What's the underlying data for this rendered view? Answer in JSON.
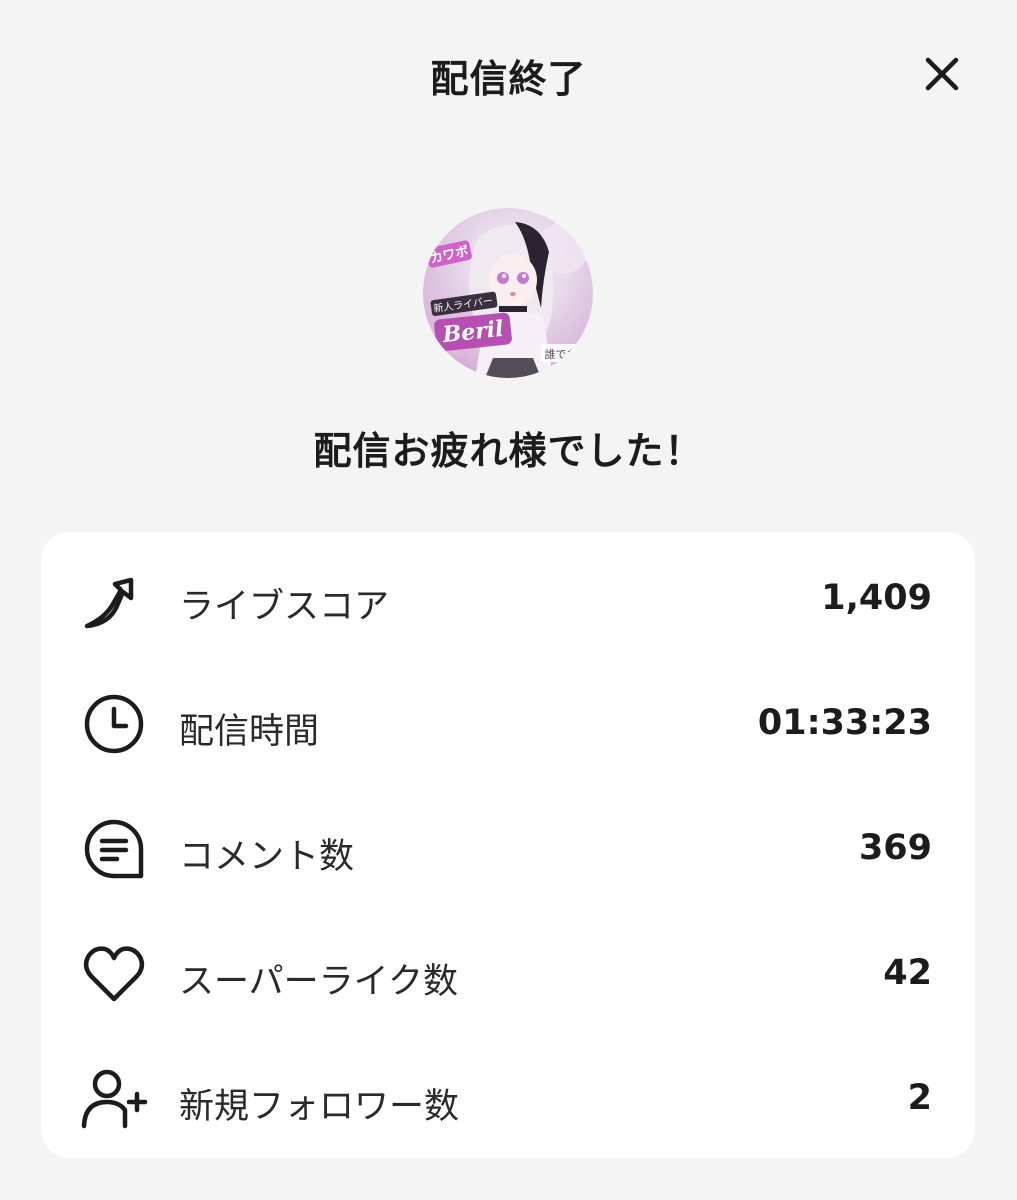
{
  "header": {
    "title": "配信終了",
    "close_icon": "close-icon"
  },
  "avatar": {
    "badge_text": "カワボ",
    "tag_text": "新人ライバー",
    "name_text": "Beril",
    "corner_text": "誰でも"
  },
  "message": "配信お疲れ様でした！",
  "stats": [
    {
      "icon": "live-score-icon",
      "label": "ライブスコア",
      "value": "1,409"
    },
    {
      "icon": "clock-icon",
      "label": "配信時間",
      "value": "01:33:23"
    },
    {
      "icon": "comment-icon",
      "label": "コメント数",
      "value": "369"
    },
    {
      "icon": "heart-icon",
      "label": "スーパーライク数",
      "value": "42"
    },
    {
      "icon": "add-user-icon",
      "label": "新規フォロワー数",
      "value": "2"
    }
  ],
  "colors": {
    "background": "#f4f4f4",
    "card": "#ffffff",
    "text": "#1c1c1c",
    "avatar_accent": "#d98ad6"
  }
}
